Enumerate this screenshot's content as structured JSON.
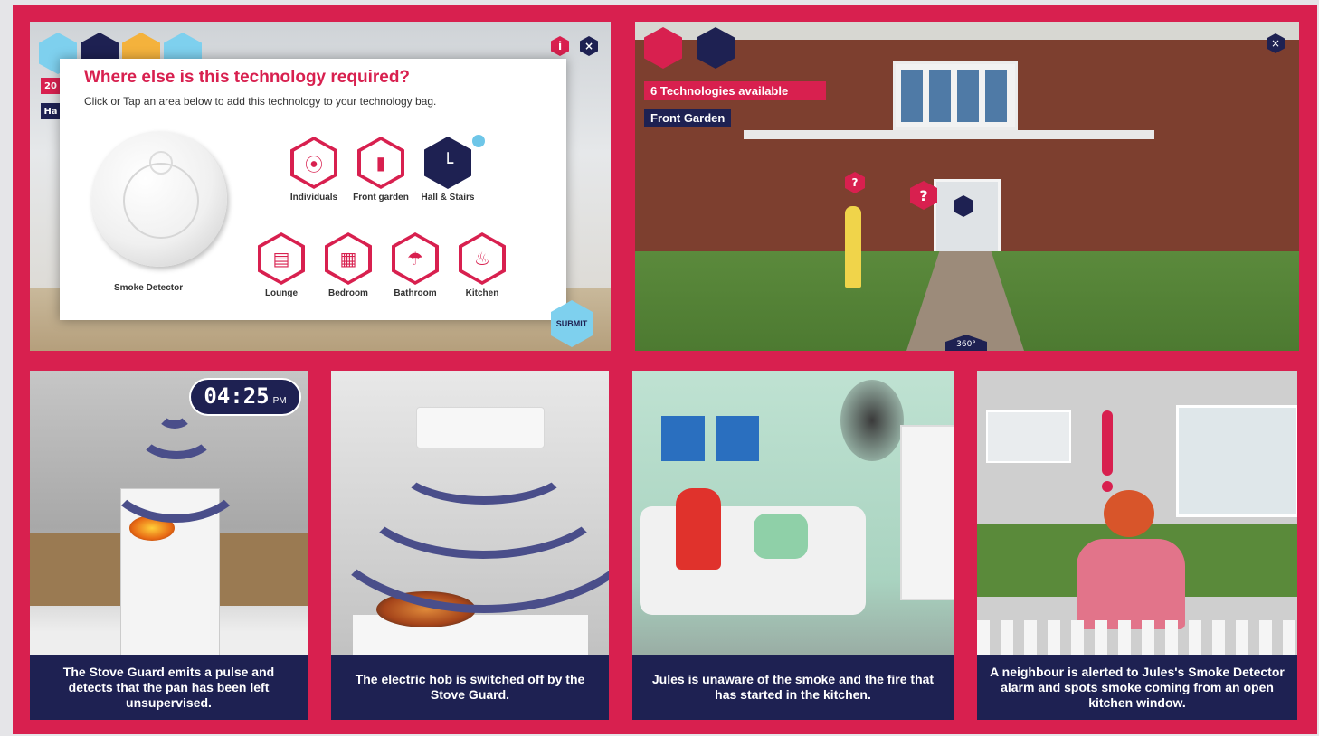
{
  "modal": {
    "title": "Where else is this technology required?",
    "subtitle": "Click or Tap an area below to add this technology to your technology bag.",
    "product_label": "Smoke Detector",
    "areas": [
      {
        "label": "Individuals",
        "icon": "person-icon"
      },
      {
        "label": "Front garden",
        "icon": "door-icon"
      },
      {
        "label": "Hall & Stairs",
        "icon": "stairs-icon",
        "selected": true
      },
      {
        "label": "Lounge",
        "icon": "sofa-icon"
      },
      {
        "label": "Bedroom",
        "icon": "bed-icon"
      },
      {
        "label": "Bathroom",
        "icon": "shower-icon"
      },
      {
        "label": "Kitchen",
        "icon": "pan-icon"
      }
    ],
    "submit_label": "SUBMIT",
    "info_label": "i",
    "close_label": "×"
  },
  "panel1_behind": {
    "badge": "20",
    "chip": "Ha"
  },
  "scene": {
    "tech_count": "6 Technologies available",
    "location": "Front Garden",
    "hotspot_label": "?",
    "view_label": "360°",
    "close_label": "×"
  },
  "clock": {
    "time": "04:25",
    "ampm": "PM"
  },
  "captions": [
    "The Stove Guard emits a pulse and detects that the pan has been left unsupervised.",
    "The electric hob is switched off by the Stove Guard.",
    "Jules is unaware of the smoke and the fire that has started in the kitchen.",
    "A neighbour is alerted to Jules's Smoke Detector alarm and spots smoke coming from an open kitchen window."
  ],
  "colors": {
    "brand": "#d8204f",
    "navy": "#1e2152",
    "sky": "#7ed0ee",
    "wave": "#4a4e8a"
  }
}
